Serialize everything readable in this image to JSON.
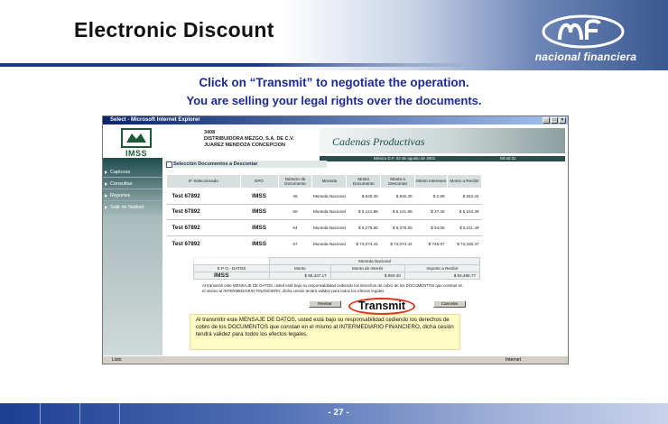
{
  "slide": {
    "title": "Electronic Discount",
    "instruction_line1": "Click on “Transmit” to negotiate the operation.",
    "instruction_line2": "You are selling your legal rights over the documents.",
    "callout_label": "Transmit",
    "page_number": "- 27 -",
    "logo_text": "nacional financiera"
  },
  "browser": {
    "window_title": "Select - Microsoft Internet Explorer",
    "company_lines": [
      "3408",
      "DISTRIBUIDORA MEZGO, S.A. DE C.V.",
      "JUAREZ MENDOZA CONCEPCION"
    ],
    "app_logo_text": "IMSS",
    "banner_text": "Cadenas Productivas",
    "date_text": "México D.F. 03 de agosto de 2001",
    "time_text": "09:40:31",
    "section_title": "Selección Documentos a Descontar",
    "sidebar_items": [
      "Capturas",
      "Consultas",
      "Reportes",
      "Salir de Nafinet"
    ],
    "table": {
      "headers": [
        "IF Seleccionado",
        "EPO",
        "Número de Documento",
        "Moneda",
        "Monto Documento",
        "Monto a Descontar",
        "Monto Intereses",
        "Monto a Recibir"
      ],
      "rows": [
        [
          "Test 67892",
          "IMSS",
          "46",
          "Moneda Nacional",
          "$ 845.30",
          "$ 845.30",
          "$ 2.88",
          "$ 842.42"
        ],
        [
          "Test 67892",
          "IMSS",
          "50",
          "Moneda Nacional",
          "$ 5,141.88",
          "$ 5,141.88",
          "$ 37.49",
          "$ 5,104.39"
        ],
        [
          "Test 67892",
          "IMSS",
          "54",
          "Moneda Nacional",
          "$ 6,275.55",
          "$ 6,275.55",
          "$ 64.06",
          "$ 6,211.49"
        ],
        [
          "Test 67892",
          "IMSS",
          "57",
          "Moneda Nacional",
          "$ 73,074.44",
          "$ 73,074.44",
          "$ 745.97",
          "$ 72,328.47"
        ]
      ]
    },
    "summary": {
      "currency_header": "Moneda Nacional",
      "row_label": "E P O - DATOS",
      "epo": "IMSS",
      "col_headers": [
        "Monto",
        "Monto de Interés",
        "Importe a Recibir"
      ],
      "values": [
        "$ 85,337.17",
        "$ 850.40",
        "$ 84,486.77"
      ]
    },
    "legal_small": "Al transmitir este MENSAJE DE DATOS, usted está bajo su responsabilidad cediendo los derechos de cobro de los DOCUMENTOS que constan en el mismo al INTERMEDIARIO FINANCIERO, dicha cesión tendrá validez para todos los efectos legales",
    "buttons": {
      "review": "Revisar",
      "cancel": "Cancelar"
    },
    "legal_big": "Al transmitir este MENSAJE DE DATOS, usted está bajo su responsabilidad cediendo los derechos de cobro de los DOCUMENTOS que constan en el mismo al INTERMEDIARIO FINANCIERO, dicha cesión tendrá validez para todos los efectos legales.",
    "status_left": "Listo",
    "status_right": "Internet"
  },
  "colors": {
    "title_text": "#111111",
    "instruction_text": "#1b2a96",
    "header_rule": "#1c3b86",
    "callout_ring": "#d8371b",
    "footer_dark": "#1d3f92"
  }
}
